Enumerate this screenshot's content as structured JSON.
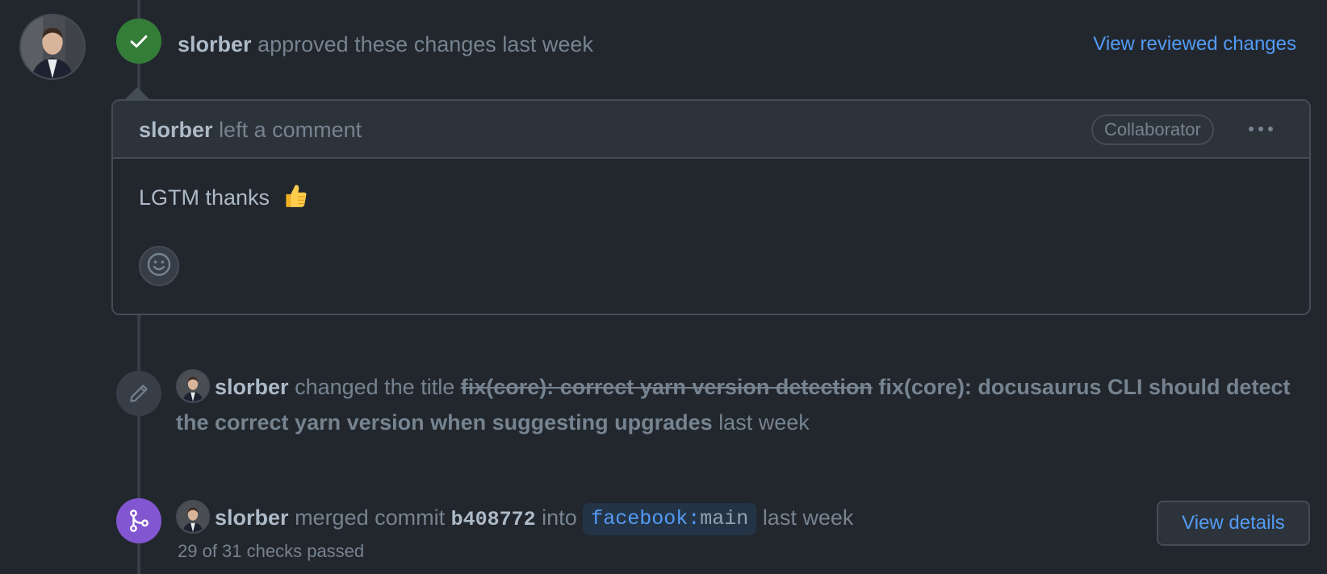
{
  "review": {
    "author": "slorber",
    "action_text": "approved these changes",
    "time": "last week",
    "view_reviewed_label": "View reviewed changes"
  },
  "comment": {
    "author": "slorber",
    "action_text": "left a comment",
    "role_badge": "Collaborator",
    "body": "LGTM thanks"
  },
  "title_change": {
    "author": "slorber",
    "action_text": "changed the title",
    "old_title": "fix(core): correct yarn version detection",
    "new_title": "fix(core): docusaurus CLI should detect the correct yarn version when suggesting upgrades",
    "time": "last week"
  },
  "merge": {
    "author": "slorber",
    "action_text": "merged commit",
    "commit": "b408772",
    "into_text": "into",
    "repo": "facebook",
    "separator": ":",
    "branch": "main",
    "time": "last week",
    "checks": "29 of 31 checks passed",
    "view_details_label": "View details"
  },
  "icons": {
    "approved": "check-icon",
    "edit": "pencil-icon",
    "merged": "git-merge-icon",
    "reaction": "smiley-icon",
    "more": "kebab-horizontal-icon"
  },
  "colors": {
    "background": "#22272e",
    "approved": "#347d39",
    "merged": "#8256d0",
    "link": "#539bf5"
  }
}
